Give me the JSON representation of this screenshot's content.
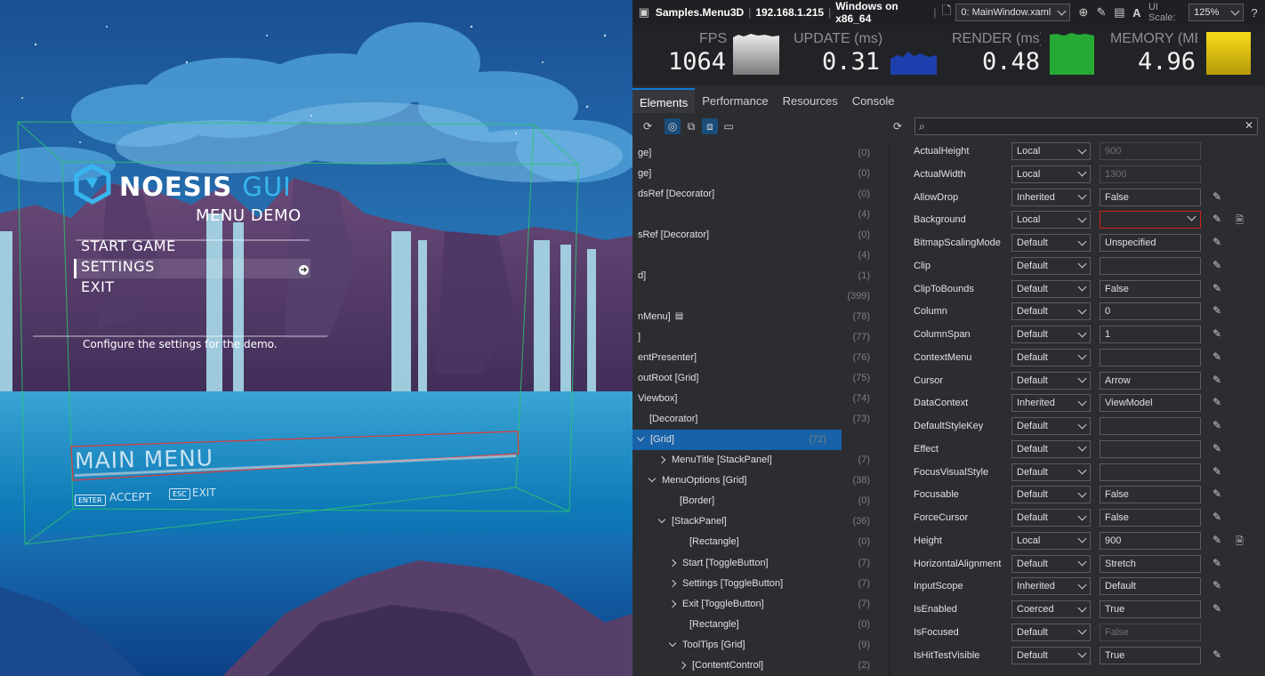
{
  "game": {
    "logo_main": "NOESIS",
    "logo_accent": "GUI",
    "subtitle": "MENU DEMO",
    "menu_items": [
      "START GAME",
      "SETTINGS",
      "EXIT"
    ],
    "hint": "Configure the settings for the demo.",
    "main_title": "MAIN MENU",
    "key_enter": "ENTER",
    "label_accept": "ACCEPT",
    "key_esc": "ESC",
    "label_exit": "EXIT",
    "colors": {
      "sky_top": "#1a4f93",
      "water": "#0f7bb8",
      "accent": "#37b5ee"
    }
  },
  "inspector": {
    "app_name": "Samples.Menu3D",
    "ip": "192.168.1.215",
    "platform": "Windows on x86_64",
    "window_select": "0: MainWindow.xaml",
    "ui_scale_label": "UI Scale:",
    "ui_scale_value": "125%",
    "font_a": "A",
    "stats": [
      {
        "label": "FPS",
        "value": "1064",
        "color": "#d8d8d8"
      },
      {
        "label": "UPDATE (ms)",
        "value": "0.31",
        "color": "#1d3fae"
      },
      {
        "label": "RENDER (ms)",
        "value": "0.48",
        "color": "#27a935"
      },
      {
        "label": "MEMORY (MB)",
        "value": "4.96",
        "color": "#e7c90f"
      }
    ],
    "tabs": [
      "Elements",
      "Performance",
      "Resources",
      "Console"
    ],
    "tree": [
      {
        "text": "ge]",
        "count": "(0)"
      },
      {
        "text": "ge]",
        "count": "(0)"
      },
      {
        "text": "dsRef [Decorator]",
        "count": "(0)"
      },
      {
        "text": "",
        "count": "(4)"
      },
      {
        "text": "sRef [Decorator]",
        "count": "(0)"
      },
      {
        "text": "",
        "count": "(4)"
      },
      {
        "text": "d]",
        "count": "(1)"
      },
      {
        "text": "",
        "count": "(399)"
      },
      {
        "text": "nMenu]",
        "count": "(78)"
      },
      {
        "text": "]",
        "count": "(77)"
      },
      {
        "text": "entPresenter]",
        "count": "(76)"
      },
      {
        "text": "outRoot [Grid]",
        "count": "(75)"
      },
      {
        "text": "Viewbox]",
        "count": "(74)"
      },
      {
        "text": "[Decorator]",
        "count": "(73)"
      },
      {
        "text": "[Grid]",
        "count": "(72)"
      },
      {
        "text": "MenuTitle [StackPanel]",
        "count": "(7)"
      },
      {
        "text": "MenuOptions [Grid]",
        "count": "(38)"
      },
      {
        "text": "[Border]",
        "count": "(0)"
      },
      {
        "text": "[StackPanel]",
        "count": "(36)"
      },
      {
        "text": "[Rectangle]",
        "count": "(0)"
      },
      {
        "text": "Start [ToggleButton]",
        "count": "(7)"
      },
      {
        "text": "Settings [ToggleButton]",
        "count": "(7)"
      },
      {
        "text": "Exit [ToggleButton]",
        "count": "(7)"
      },
      {
        "text": "[Rectangle]",
        "count": "(0)"
      },
      {
        "text": "ToolTips [Grid]",
        "count": "(9)"
      },
      {
        "text": "[ContentControl]",
        "count": "(2)"
      }
    ],
    "properties": [
      {
        "name": "ActualHeight",
        "source": "Local",
        "value": "900"
      },
      {
        "name": "ActualWidth",
        "source": "Local",
        "value": "1300"
      },
      {
        "name": "AllowDrop",
        "source": "Inherited",
        "value": "False"
      },
      {
        "name": "Background",
        "source": "Local",
        "value": ""
      },
      {
        "name": "BitmapScalingMode",
        "source": "Default",
        "value": "Unspecified"
      },
      {
        "name": "Clip",
        "source": "Default",
        "value": ""
      },
      {
        "name": "ClipToBounds",
        "source": "Default",
        "value": "False"
      },
      {
        "name": "Column",
        "source": "Default",
        "value": "0"
      },
      {
        "name": "ColumnSpan",
        "source": "Default",
        "value": "1"
      },
      {
        "name": "ContextMenu",
        "source": "Default",
        "value": ""
      },
      {
        "name": "Cursor",
        "source": "Default",
        "value": "Arrow"
      },
      {
        "name": "DataContext",
        "source": "Inherited",
        "value": "ViewModel"
      },
      {
        "name": "DefaultStyleKey",
        "source": "Default",
        "value": ""
      },
      {
        "name": "Effect",
        "source": "Default",
        "value": ""
      },
      {
        "name": "FocusVisualStyle",
        "source": "Default",
        "value": ""
      },
      {
        "name": "Focusable",
        "source": "Default",
        "value": "False"
      },
      {
        "name": "ForceCursor",
        "source": "Default",
        "value": "False"
      },
      {
        "name": "Height",
        "source": "Local",
        "value": "900"
      },
      {
        "name": "HorizontalAlignment",
        "source": "Default",
        "value": "Stretch"
      },
      {
        "name": "InputScope",
        "source": "Inherited",
        "value": "Default"
      },
      {
        "name": "IsEnabled",
        "source": "Coerced",
        "value": "True"
      },
      {
        "name": "IsFocused",
        "source": "Default",
        "value": "False"
      },
      {
        "name": "IsHitTestVisible",
        "source": "Default",
        "value": "True"
      }
    ]
  }
}
